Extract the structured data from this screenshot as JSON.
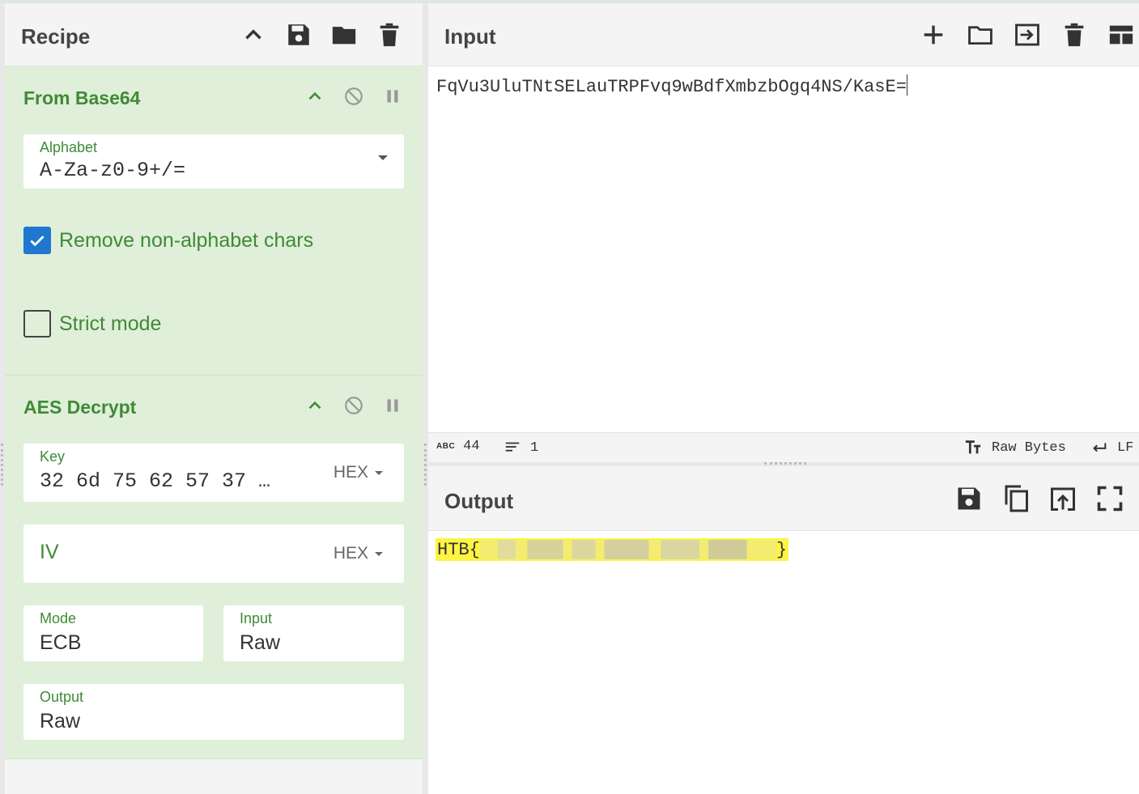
{
  "recipe": {
    "title": "Recipe",
    "icons": [
      "chevron-up-icon",
      "save-icon",
      "folder-icon",
      "trash-icon"
    ],
    "operations": [
      {
        "title": "From Base64",
        "alphabet": {
          "label": "Alphabet",
          "value": "A-Za-z0-9+/="
        },
        "remove_non_alphabet": {
          "label": "Remove non-alphabet chars",
          "checked": true
        },
        "strict_mode": {
          "label": "Strict mode",
          "checked": false
        }
      },
      {
        "title": "AES Decrypt",
        "key": {
          "label": "Key",
          "value": "32 6d 75 62 57 37 …",
          "format": "HEX"
        },
        "iv": {
          "placeholder": "IV",
          "value": "",
          "format": "HEX"
        },
        "mode": {
          "label": "Mode",
          "value": "ECB"
        },
        "input": {
          "label": "Input",
          "value": "Raw"
        },
        "output": {
          "label": "Output",
          "value": "Raw"
        }
      }
    ]
  },
  "input": {
    "title": "Input",
    "text": "FqVu3UluTNtSELauTRPFvq9wBdfXmbzbOgq4NS/KasE=",
    "status": {
      "chars_label": "ABC",
      "chars": "44",
      "lines": "1",
      "encoding": "Raw Bytes",
      "eol": "LF"
    }
  },
  "output": {
    "title": "Output",
    "text_prefix": "HTB{",
    "text_suffix": "}",
    "highlight_color": "#fdf443"
  },
  "colors": {
    "accent_green": "#3f8a37",
    "op_bg": "#e0efd9",
    "checkbox_blue": "#1f77d0"
  }
}
